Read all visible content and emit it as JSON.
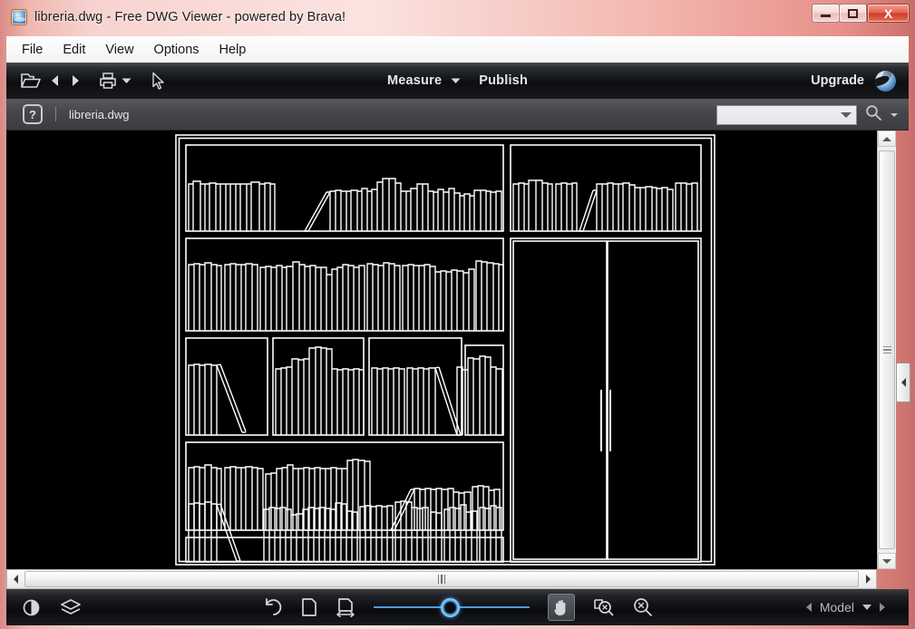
{
  "window": {
    "title": "libreria.dwg - Free DWG Viewer - powered by Brava!",
    "app_icon": "brava-globe-icon",
    "controls": {
      "minimize": "minimize-icon",
      "maximize": "maximize-icon",
      "close": "X"
    },
    "accent_color": "#e8908a",
    "titlebar_color": "#f7d3cf"
  },
  "menubar": {
    "items": [
      {
        "label": "File"
      },
      {
        "label": "Edit"
      },
      {
        "label": "View"
      },
      {
        "label": "Options"
      },
      {
        "label": "Help"
      }
    ]
  },
  "toolbar": {
    "open_icon": "open-folder-icon",
    "prev_icon": "previous-page-icon",
    "next_icon": "next-page-icon",
    "print_icon": "print-icon",
    "print_caret_icon": "chevron-down-icon",
    "select_icon": "select-cursor-icon",
    "measure_label": "Measure",
    "measure_caret_icon": "chevron-down-icon",
    "publish_label": "Publish",
    "upgrade_label": "Upgrade",
    "brava_logo_icon": "brava-globe-icon",
    "background_color": "#0c0d0f"
  },
  "docbar": {
    "help_icon": "help-question-icon",
    "document_name": "libreria.dwg",
    "search": {
      "value": "",
      "placeholder": "",
      "dropdown_icon": "chevron-down-icon",
      "search_icon": "magnifier-icon",
      "search_caret_icon": "chevron-down-icon"
    },
    "background_color": "#44464c"
  },
  "canvas": {
    "background_color": "#000000",
    "line_color": "#ffffff",
    "drawing_name": "bookcase-elevation-drawing"
  },
  "scrollbars": {
    "vertical": {
      "up_icon": "scroll-up-arrow-icon",
      "down_icon": "scroll-down-arrow-icon",
      "thumb_grip_icon": "scrollbar-grip-icon"
    },
    "horizontal": {
      "left_icon": "scroll-left-arrow-icon",
      "right_icon": "scroll-right-arrow-icon",
      "thumb_grip_icon": "scrollbar-grip-icon"
    },
    "panel_toggle_icon": "collapse-panel-arrow-icon"
  },
  "statusbar": {
    "contrast_icon": "contrast-icon",
    "layers_icon": "layers-icon",
    "rotate_icon": "rotate-left-icon",
    "fit_page_icon": "fit-page-icon",
    "fit_width_icon": "fit-width-icon",
    "zoom_slider_value": 50,
    "pan_icon": "pan-hand-icon",
    "zoom_in_icon": "zoom-in-icon",
    "zoom_out_icon": "zoom-out-icon",
    "nav_prev_icon": "previous-sheet-icon",
    "sheet_label": "Model",
    "sheet_caret_icon": "chevron-down-icon",
    "nav_next_icon": "next-sheet-icon",
    "background_color": "#0a0b0d"
  },
  "drawing_data": {
    "type": "cad-elevation",
    "description": "Bookcase / wardrobe elevation in white line art on black background",
    "units": "drawing units",
    "shelves": [
      {
        "id": "top-left-shelf",
        "books_groups": [
          14,
          22
        ]
      },
      {
        "id": "top-right-shelf",
        "books_groups": [
          9,
          13
        ]
      },
      {
        "id": "second-row-shelf",
        "books_groups": [
          40
        ]
      },
      {
        "id": "cubby-left",
        "books_groups": [
          5
        ]
      },
      {
        "id": "cubby-center",
        "books_groups": [
          14
        ]
      },
      {
        "id": "cubby-right",
        "books_groups": [
          12
        ]
      },
      {
        "id": "cubby-far-right",
        "books_groups": [
          8
        ]
      },
      {
        "id": "fourth-row-shelf",
        "books_groups": [
          30
        ]
      },
      {
        "id": "bottom-row-shelf",
        "books_groups": [
          34
        ]
      }
    ],
    "wardrobe": {
      "id": "two-door-wardrobe",
      "doors": 2,
      "handles": 2
    }
  }
}
